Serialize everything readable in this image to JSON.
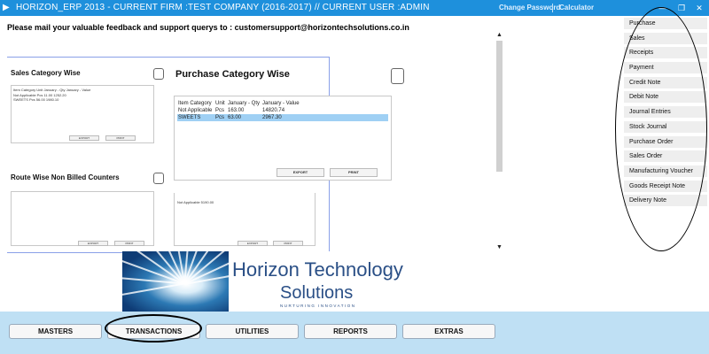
{
  "titlebar": {
    "title": "HORIZON_ERP 2013 - CURRENT FIRM :TEST COMPANY (2016-2017) // CURRENT USER :ADMIN",
    "change_password": "Change Password",
    "calculator": "Calculator",
    "minimize": "—",
    "maximize": "❐",
    "close": "✕"
  },
  "feedback": "Please mail your valuable feedback and support querys to : customersupport@horizontechsolutions.co.in",
  "sections": {
    "sales_category": {
      "title": "Sales Category Wise",
      "headers": "Item Category   Unit   January - Qty   January - Value",
      "rows": [
        "Not Applicable  Pcs     11.00        1252.20",
        "SWEETS            Pcs     56.00        1980.10"
      ],
      "export": "EXPORT",
      "print": "PRINT"
    },
    "purchase_category": {
      "title": "Purchase Category Wise",
      "headers": [
        "Item Category",
        "Unit",
        "January - Qty",
        "January - Value"
      ],
      "rows": [
        [
          "Not Applicable",
          "Pcs",
          "163.00",
          "14820.74"
        ],
        [
          "SWEETS",
          "Pcs",
          "63.00",
          "2967.30"
        ]
      ],
      "export": "EXPORT",
      "print": "PRINT"
    },
    "route_wise": {
      "title": "Route Wise Non Billed Counters",
      "export": "EXPORT",
      "print": "PRINT"
    },
    "fourth": {
      "row": "Not Applicable 5190.00",
      "export": "EXPORT",
      "print": "PRINT"
    }
  },
  "menu": [
    "Purchase",
    "Sales",
    "Receipts",
    "Payment",
    "Credit Note",
    "Debit Note",
    "Journal Entries",
    "Stock Journal",
    "Purchase Order",
    "Sales Order",
    "Manufacturing Voucher",
    "Goods Receipt Note",
    "Delivery Note"
  ],
  "logo": {
    "line1": "Horizon Technology",
    "line2": "Solutions",
    "tagline": "NURTURING INNOVATION"
  },
  "nav": [
    "MASTERS",
    "TRANSACTIONS",
    "UTILITIES",
    "REPORTS",
    "EXTRAS"
  ],
  "colors": {
    "titlebar": "#1e90dc",
    "bottombar": "#bfe0f4",
    "selected_row": "#9fd0f4"
  }
}
